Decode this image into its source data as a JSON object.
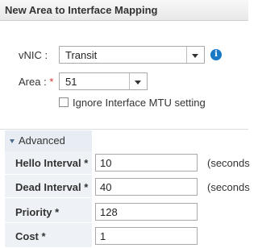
{
  "dialog": {
    "title": "New Area to Interface Mapping"
  },
  "form": {
    "vnic": {
      "label": "vNIC :",
      "value": "Transit"
    },
    "area": {
      "label": "Area :",
      "required_mark": "*",
      "value": "51"
    },
    "ignore_mtu": {
      "label": "Ignore Interface MTU setting",
      "checked": false
    }
  },
  "advanced": {
    "header": "Advanced",
    "fields": [
      {
        "label": "Hello Interval *",
        "value": "10",
        "unit": "(seconds"
      },
      {
        "label": "Dead Interval *",
        "value": "40",
        "unit": "(seconds"
      },
      {
        "label": "Priority *",
        "value": "128"
      },
      {
        "label": "Cost *",
        "value": "1"
      }
    ]
  },
  "colors": {
    "info_icon": "#1a79c6",
    "required": "#d9342b",
    "advanced_bg": "#eef2f6"
  }
}
